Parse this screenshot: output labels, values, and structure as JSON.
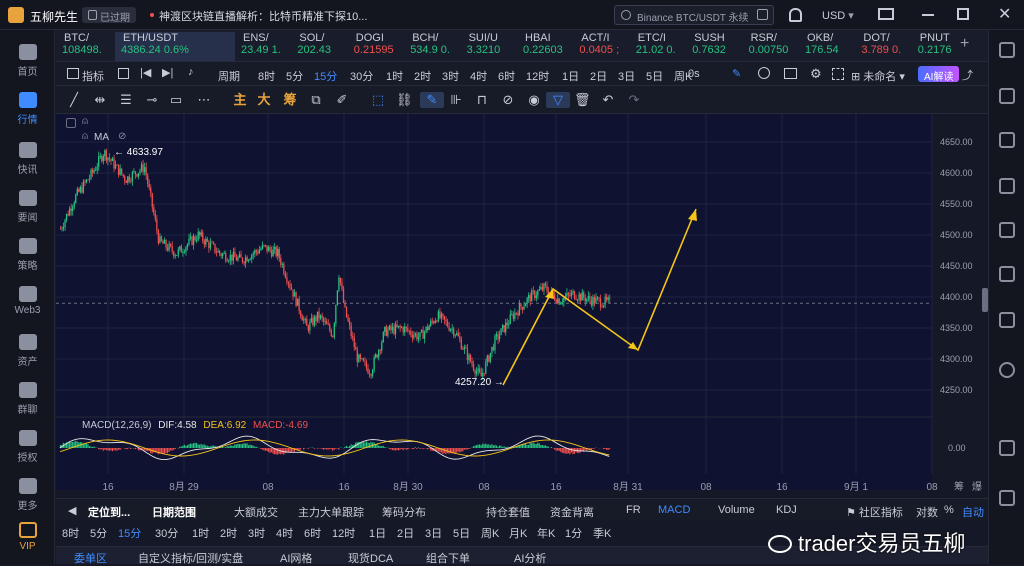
{
  "app": {
    "title": "五柳先生",
    "badge": "已过期",
    "news": "神渡区块链直播解析：比特币精准下探10..."
  },
  "search": {
    "placeholder": "Binance BTC/USDT 永续"
  },
  "currency": "USD",
  "leftnav": [
    {
      "label": "首页",
      "icon": "home-icon"
    },
    {
      "label": "行情",
      "icon": "market-icon"
    },
    {
      "label": "快讯",
      "icon": "flash-news-icon"
    },
    {
      "label": "要闻",
      "icon": "news-icon"
    },
    {
      "label": "策略",
      "icon": "strategy-icon"
    },
    {
      "label": "Web3",
      "icon": "web3-icon"
    },
    {
      "label": "资产",
      "icon": "wallet-icon"
    },
    {
      "label": "群聊",
      "icon": "chat-icon"
    },
    {
      "label": "授权",
      "icon": "key-icon"
    },
    {
      "label": "更多",
      "icon": "more-icon"
    },
    {
      "label": "VIP",
      "icon": "vip-icon"
    }
  ],
  "tickers": [
    {
      "name": "BTC/",
      "price": "108498.",
      "dir": "up"
    },
    {
      "name": "ETH/USDT",
      "price": "4386.24  0.6%",
      "dir": "up"
    },
    {
      "name": "ENS/",
      "price": "23.49  1.",
      "dir": "up"
    },
    {
      "name": "SOL/",
      "price": "202.43",
      "dir": "up"
    },
    {
      "name": "DOGI",
      "price": "0.21595",
      "dir": "dn"
    },
    {
      "name": "BCH/",
      "price": "534.9  0.",
      "dir": "up"
    },
    {
      "name": "SUI/U",
      "price": "3.3210",
      "dir": "up"
    },
    {
      "name": "HBAI",
      "price": "0.22603",
      "dir": "up"
    },
    {
      "name": "ACT/I",
      "price": "0.0405 ;",
      "dir": "dn"
    },
    {
      "name": "ETC/I",
      "price": "21.02  0.",
      "dir": "up"
    },
    {
      "name": "SUSH",
      "price": "0.7632",
      "dir": "up"
    },
    {
      "name": "RSR/",
      "price": "0.00750",
      "dir": "up"
    },
    {
      "name": "OKB/",
      "price": "176.54",
      "dir": "up"
    },
    {
      "name": "DOT/",
      "price": "3.789  0.",
      "dir": "dn"
    },
    {
      "name": "PNUT",
      "price": "0.2176",
      "dir": "up"
    }
  ],
  "periodbar": {
    "indicator": "指标",
    "items": [
      "周期",
      "8时",
      "5分",
      "15分",
      "30分",
      "1时",
      "2时",
      "3时",
      "4时",
      "6时",
      "12时",
      "1日",
      "2日",
      "3日",
      "5日",
      "周K"
    ],
    "selected": "15分",
    "right0": "0s",
    "unnamed": "未命名",
    "ai": "AI解读"
  },
  "drawbar": {
    "main": "主",
    "big": "大",
    "chip": "筹"
  },
  "chart": {
    "ma_label": "MA",
    "high_label": "4633.97",
    "low_label": "4257.20",
    "macd": {
      "name": "MACD(12,26,9)",
      "dif": "DIF:4.58",
      "dea": "DEA:6.92",
      "macd": "MACD:-4.69"
    },
    "price_ticks": [
      "4650.00",
      "4600.00",
      "4550.00",
      "4500.00",
      "4450.00",
      "4400.00",
      "4350.00",
      "4300.00",
      "4250.00"
    ],
    "macd_tick": "0.00",
    "time_ticks": [
      "16",
      "8月 29",
      "08",
      "16",
      "8月 30",
      "08",
      "16",
      "8月 31",
      "08",
      "16",
      "9月 1",
      "08"
    ],
    "axis_labels": [
      "筹",
      "爆"
    ],
    "colors": {
      "up": "#26c281",
      "down": "#f0504f",
      "arrow": "#f5c518",
      "dif": "#e8e8e8",
      "dea": "#f5c518"
    }
  },
  "chart_data": {
    "type": "candlestick",
    "symbol": "ETH/USDT",
    "interval": "15分",
    "ylim": [
      4225,
      4675
    ],
    "x_ticks": [
      "16",
      "8月 29",
      "08",
      "16",
      "8月 30",
      "08",
      "16",
      "8月 31",
      "08",
      "16",
      "9月 1",
      "08"
    ],
    "annotations": [
      {
        "type": "high",
        "value": 4633.97
      },
      {
        "type": "low",
        "value": 4257.2
      }
    ],
    "projection": [
      {
        "t": 1,
        "price": 4257
      },
      {
        "t": 2,
        "price": 4418
      },
      {
        "t": 3,
        "price": 4313
      },
      {
        "t": 4,
        "price": 4542
      }
    ],
    "last_price": 4390,
    "macd": {
      "dif": 4.58,
      "dea": 6.92,
      "macd": -4.69
    }
  },
  "bottombar1": {
    "locate": "定位到...",
    "range": "日期范围",
    "items": [
      "大额成交",
      "主力大单跟踪",
      "筹码分布",
      "持仓套值",
      "资金背离",
      "FR",
      "MACD",
      "Volume",
      "KDJ"
    ],
    "selected": "MACD",
    "community": "社区指标",
    "log": "对数",
    "pct": "%",
    "auto": "自动"
  },
  "bottombar2": {
    "items": [
      "8时",
      "5分",
      "15分",
      "30分",
      "1时",
      "2时",
      "3时",
      "4时",
      "6时",
      "12时",
      "1日",
      "2日",
      "3日",
      "5日",
      "周K",
      "月K",
      "年K",
      "1分",
      "季K"
    ],
    "selected": "15分"
  },
  "bottombar3": {
    "items": [
      "委单区",
      "自定义指标/回测/实盘",
      "AI网格",
      "现货DCA",
      "组合下单",
      "AI分析"
    ]
  },
  "watermark": "trader交易员五柳"
}
